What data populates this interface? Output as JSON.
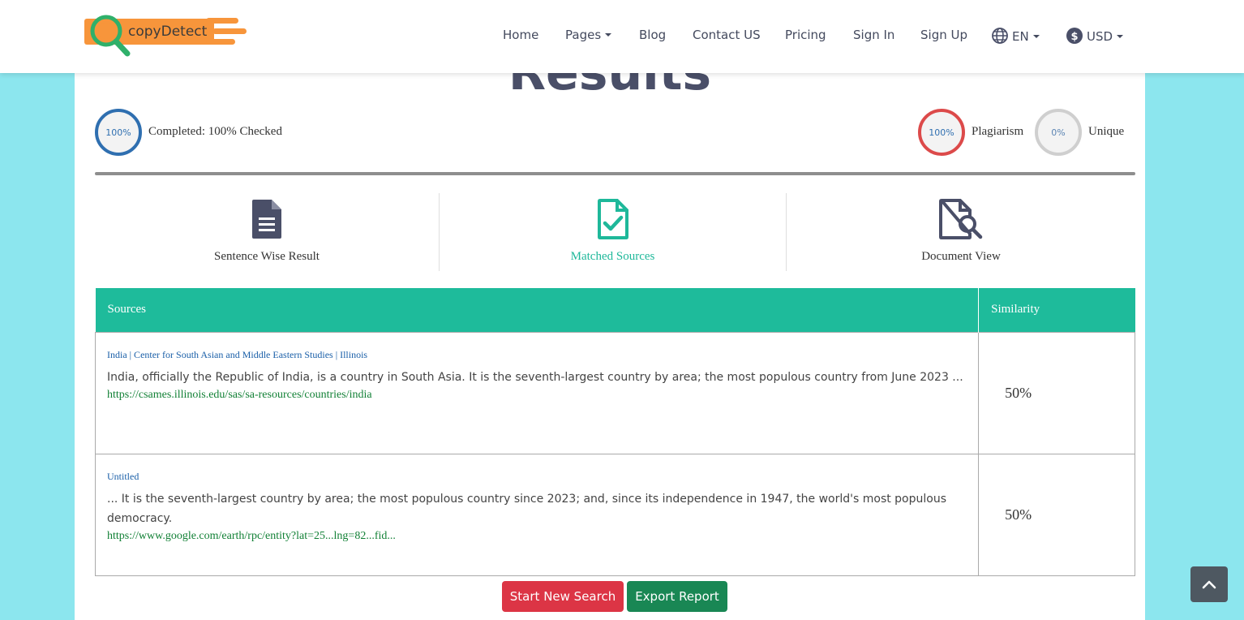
{
  "brand": {
    "name": "copyDetect"
  },
  "nav": {
    "home": "Home",
    "pages": "Pages",
    "blog": "Blog",
    "contact": "Contact US",
    "pricing": "Pricing",
    "signin": "Sign In",
    "signup": "Sign Up",
    "language": "EN",
    "currency": "USD"
  },
  "results": {
    "title": "Results",
    "completed_value": "100%",
    "completed_label": "Completed: 100% Checked",
    "plagiarism_value": "100%",
    "plagiarism_label": "Plagiarism",
    "unique_value": "0%",
    "unique_label": "Unique"
  },
  "tabs": {
    "sentence": "Sentence Wise Result",
    "matched": "Matched Sources",
    "document": "Document View"
  },
  "table": {
    "headers": {
      "sources": "Sources",
      "similarity": "Similarity"
    },
    "rows": [
      {
        "title": "India | Center for South Asian and Middle Eastern Studies | Illinois",
        "text": "India, officially the Republic of India, is a country in South Asia. It is the seventh-largest country by area; the most populous country from June 2023 ...",
        "url": "https://csames.illinois.edu/sas/sa-resources/countries/india",
        "similarity": "50%"
      },
      {
        "title": "Untitled",
        "text": "... It is the seventh-largest country by area; the most populous country since 2023; and, since its independence in 1947, the world's most populous democracy.",
        "url": "https://www.google.com/earth/rpc/entity?lat=25...lng=82...fid...",
        "similarity": "50%"
      }
    ]
  },
  "actions": {
    "new_search": "Start New Search",
    "export": "Export Report"
  },
  "colors": {
    "accent_teal": "#1ebb9b",
    "page_bg": "#8ce6ee",
    "danger": "#dc3545",
    "success": "#198754",
    "logo_orange": "#f7953b",
    "logo_green": "#2fb06a"
  },
  "icons": {
    "language": "globe-icon",
    "currency": "dollar-circle-icon",
    "sentence": "document-lines-icon",
    "matched": "document-check-icon",
    "document": "document-search-icon",
    "scroll": "chevron-up-icon"
  }
}
